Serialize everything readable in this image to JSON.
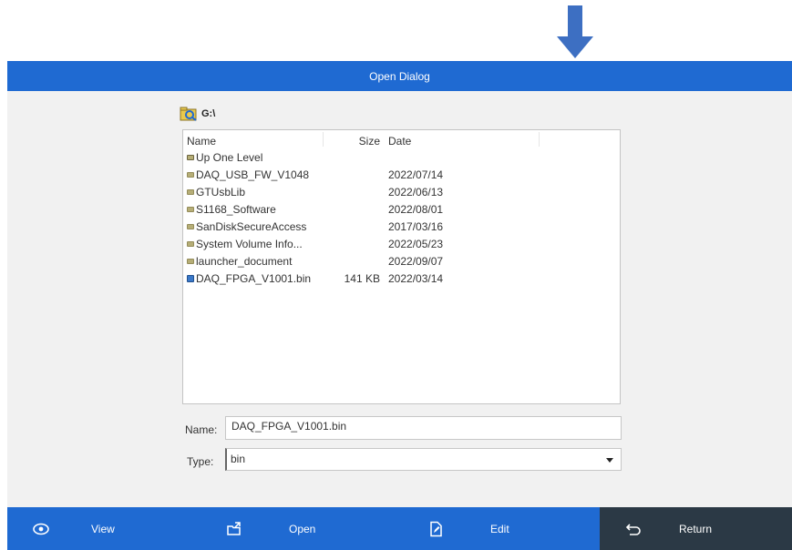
{
  "window": {
    "title": "Open Dialog"
  },
  "location": {
    "drive": "G:\\",
    "drive_icon": "drive-folder-icon"
  },
  "file_list": {
    "columns": {
      "name": "Name",
      "size": "Size",
      "date": "Date"
    },
    "rows": [
      {
        "name": "Up One Level",
        "size": "",
        "date": "",
        "icon": "up-folder-icon"
      },
      {
        "name": "DAQ_USB_FW_V1048",
        "size": "",
        "date": "2022/07/14",
        "icon": "folder-icon"
      },
      {
        "name": "GTUsbLib",
        "size": "",
        "date": "2022/06/13",
        "icon": "folder-icon"
      },
      {
        "name": "S1168_Software",
        "size": "",
        "date": "2022/08/01",
        "icon": "folder-icon"
      },
      {
        "name": "SanDiskSecureAccess",
        "size": "",
        "date": "2017/03/16",
        "icon": "folder-icon"
      },
      {
        "name": "System Volume Info...",
        "size": "",
        "date": "2022/05/23",
        "icon": "folder-icon"
      },
      {
        "name": "launcher_document",
        "size": "",
        "date": "2022/09/07",
        "icon": "folder-icon"
      },
      {
        "name": "DAQ_FPGA_V1001.bin",
        "size": "141 KB",
        "date": "2022/03/14",
        "icon": "file-icon"
      }
    ]
  },
  "form": {
    "name_label": "Name:",
    "name_value": "DAQ_FPGA_V1001.bin",
    "type_label": "Type:",
    "type_value": "bin"
  },
  "toolbar": {
    "view": "View",
    "open": "Open",
    "edit": "Edit",
    "return": "Return"
  },
  "colors": {
    "accent": "#1f6ad2",
    "return_bg": "#2b3945",
    "content_bg": "#f1f1f1"
  }
}
